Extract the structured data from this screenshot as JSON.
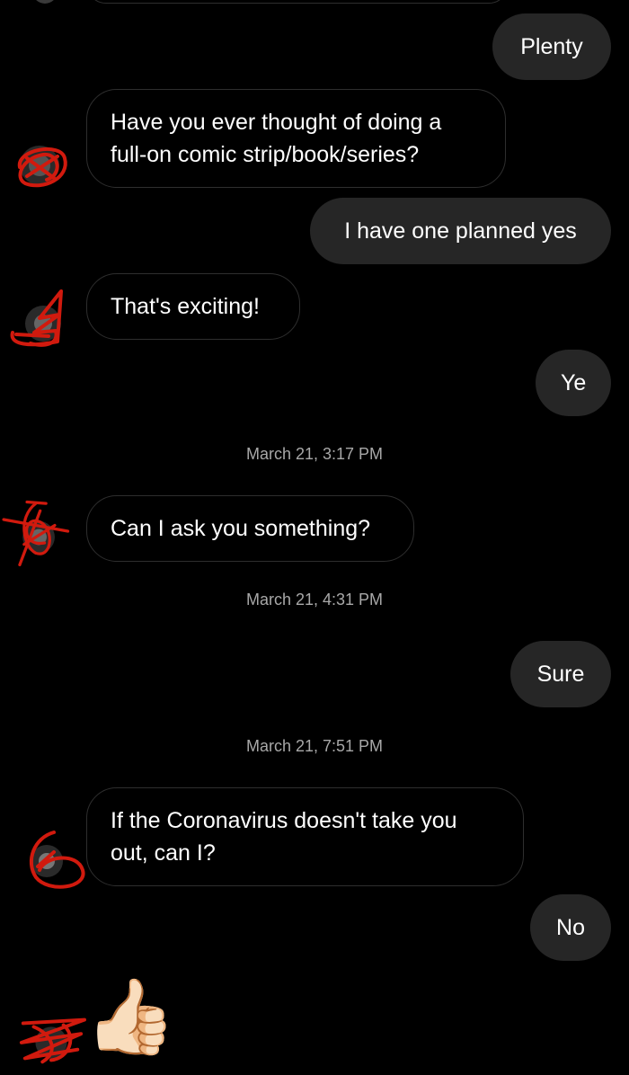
{
  "messages": {
    "m1_out": "Plenty",
    "m2_in": "Have you ever thought of doing a full-on comic strip/book/series?",
    "m3_out": "I have one planned yes",
    "m4_in": "That's exciting!",
    "m5_out": "Ye",
    "ts1": "March 21, 3:17 PM",
    "m6_in": "Can I ask you something?",
    "ts2": "March 21, 4:31 PM",
    "m7_out": "Sure",
    "ts3": "March 21, 7:51 PM",
    "m8_in": "If the Coronavirus doesn't take you out, can I?",
    "m9_out": "No",
    "m10_in_emoji": "👍🏻"
  },
  "colors": {
    "background": "#000000",
    "outgoing_bubble": "#262626",
    "incoming_border": "#2e2e2e",
    "timestamp": "#a8a8a8",
    "redaction_scribble": "#d11a0e"
  },
  "icons": {
    "avatar": "avatar-redacted",
    "thumbs_up": "thumbs-up-emoji"
  }
}
